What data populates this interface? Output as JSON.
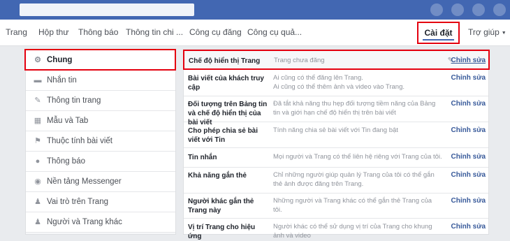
{
  "nav": {
    "items": [
      "Trang",
      "Hộp thư",
      "Thông báo",
      "Thông tin chi ...",
      "Công cụ đăng",
      "Công cụ quả..."
    ],
    "settings_label": "Cài đặt",
    "help_label": "Trợ giúp"
  },
  "sidebar": {
    "items": [
      {
        "label": "Chung",
        "icon": "gear-icon"
      },
      {
        "label": "Nhắn tin",
        "icon": "chat-icon"
      },
      {
        "label": "Thông tin trang",
        "icon": "pencil-icon"
      },
      {
        "label": "Mẫu và Tab",
        "icon": "grid-icon"
      },
      {
        "label": "Thuộc tính bài viết",
        "icon": "flag-icon"
      },
      {
        "label": "Thông báo",
        "icon": "globe-icon"
      },
      {
        "label": "Nền tảng Messenger",
        "icon": "messenger-icon"
      },
      {
        "label": "Vai trò trên Trang",
        "icon": "person-icon"
      },
      {
        "label": "Người và Trang khác",
        "icon": "people-icon"
      }
    ]
  },
  "settings_rows": [
    {
      "label": "Chế độ hiển thị Trang",
      "desc": "Trang chưa đăng",
      "edit": "Chỉnh sửa"
    },
    {
      "label": "Bài viết của khách truy cập",
      "desc": "Ai cũng có thể đăng lên Trang.\nAi cũng có thể thêm ảnh và video vào Trang.",
      "edit": "Chỉnh sửa"
    },
    {
      "label": "Đối tượng trên Bảng tin và chế độ hiển thị của bài viết",
      "desc": "Đã tắt khả năng thu hẹp đối tượng tiềm năng của Bảng tin và giới hạn chế độ hiển thị trên bài viết",
      "edit": "Chỉnh sửa"
    },
    {
      "label": "Cho phép chia sẻ bài viết với Tin",
      "desc": "Tính năng chia sẻ bài viết với Tin đang bật",
      "edit": "Chỉnh sửa"
    },
    {
      "label": "Tin nhắn",
      "desc": "Mọi người và Trang có thể liên hệ riêng với Trang của tôi.",
      "edit": "Chỉnh sửa"
    },
    {
      "label": "Khả năng gắn thẻ",
      "desc": "Chỉ những người giúp quản lý Trang của tôi có thể gắn thẻ ảnh được đăng trên Trang.",
      "edit": "Chỉnh sửa"
    },
    {
      "label": "Người khác gắn thẻ Trang này",
      "desc": "Những người và Trang khác có thể gắn thẻ Trang của tôi.",
      "edit": "Chỉnh sửa"
    },
    {
      "label": "Vị trí Trang cho hiệu ứng",
      "desc": "Người khác có thể sử dụng vị trí của Trang cho khung ảnh và video",
      "edit": "Chỉnh sửa"
    }
  ],
  "colors": {
    "brand": "#4267b2",
    "highlight": "#e4000f",
    "link": "#365899"
  }
}
